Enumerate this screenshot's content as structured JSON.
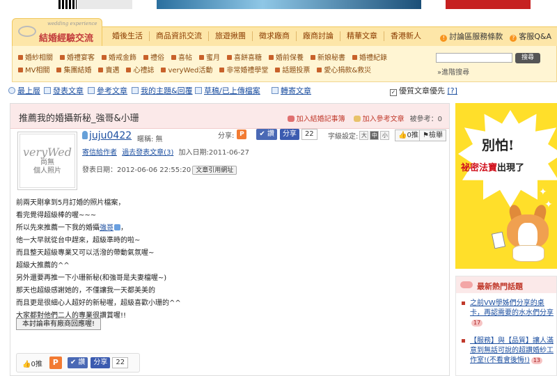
{
  "header": {
    "logo_small": "wedding experience",
    "logo_text": "結婚經驗交流",
    "nav": [
      "婚後生活",
      "商品資訊交流",
      "旅遊揪團",
      "徵求廠商",
      "廠商討論",
      "精華文章",
      "香港新人"
    ],
    "nav_right": [
      "討論區服務條款",
      "客服Q&A"
    ],
    "sub_row1": [
      "婚紗相關",
      "婚禮宴客",
      "婚戒金飾",
      "禮俗",
      "喜帖",
      "蜜月",
      "喜餅喜糖",
      "婚前保養",
      "新娘秘書",
      "婚禮紀錄"
    ],
    "sub_row2": [
      "MV相關",
      "集團結婚",
      "賣邁",
      "心禮誌",
      "veryWed活動",
      "非常婚禮學堂",
      "話題投票",
      "愛心捐款&救災"
    ],
    "search_btn": "搜尋",
    "adv_search": "»進階搜尋"
  },
  "tools": {
    "items": [
      "最上層",
      "發表文章",
      "參考文章",
      "我的主題&回覆",
      "草稿/已上傳檔案",
      "轉寄文章"
    ],
    "pref": "優質文章優先",
    "help": "[?]",
    "pref_checked": true
  },
  "post": {
    "title": "推薦我的婚攝新秘_強哥&小珊",
    "add_record": "加入結婚記事簿",
    "add_ref": "加入參考文章",
    "ref_count": "被參考：0",
    "avatar_logo": "veryWed",
    "avatar_l1": "尚無",
    "avatar_l2": "個人照片",
    "username": "juju0422",
    "nickname": "暱稱: 無",
    "user_link1": "寄信給作者",
    "user_link2": "過去發表文章(3)",
    "joined": "加入日期:2011-06-27",
    "posted": "發表日期：2012-06-06 22:55:20",
    "cite_btn": "文章引用網址",
    "share_label": "分享:",
    "plurk": "P",
    "like": "讚",
    "share": "分享",
    "share_count": "22",
    "font_label": "字級設定:",
    "font_sizes": [
      "大",
      "中",
      "小"
    ],
    "vote": "0推",
    "report": "檢舉",
    "body": [
      "前兩天剛拿到5月訂婚的照片檔案，",
      "看完覺得超級棒的喔~~~",
      "所以先來推薦一下我的婚攝",
      "他一大早就從台中趕來，超級準時的啦~",
      "而且整天超級專業又可以活潑的帶動氣氛喔~",
      "超級大推薦的^^",
      "另外還要再推一下小珊新秘(和強哥是夫妻檔喔~)",
      "那天也超級感謝她的，不僅讓我一天都美美的",
      "而且更是很細心人超好的新秘喔，超級喜歡小珊的^^",
      "大家都對他們二人的專業很讚賞喔!!"
    ],
    "inline_link": "強哥",
    "reply_btn": "本討論串有廠商回應喔!",
    "bottom_vote": "0推",
    "bottom_like": "讚",
    "bottom_share": "分享",
    "bottom_count": "22"
  },
  "sidebar": {
    "ad_t1": "別怕!",
    "ad_t2_red": "祕密法寶",
    "ad_t2_rest": "出現了",
    "hot_title": "最新熱門話題",
    "hot": [
      {
        "text": "之前VW學姊們分享的桌卡，再認需要的水水們分享",
        "badge": "17"
      },
      {
        "text": "【服務】與【品質】讓人滿意到無話可說的超讚婚紗工作室!(不看會後悔!)",
        "badge": "13"
      }
    ]
  }
}
